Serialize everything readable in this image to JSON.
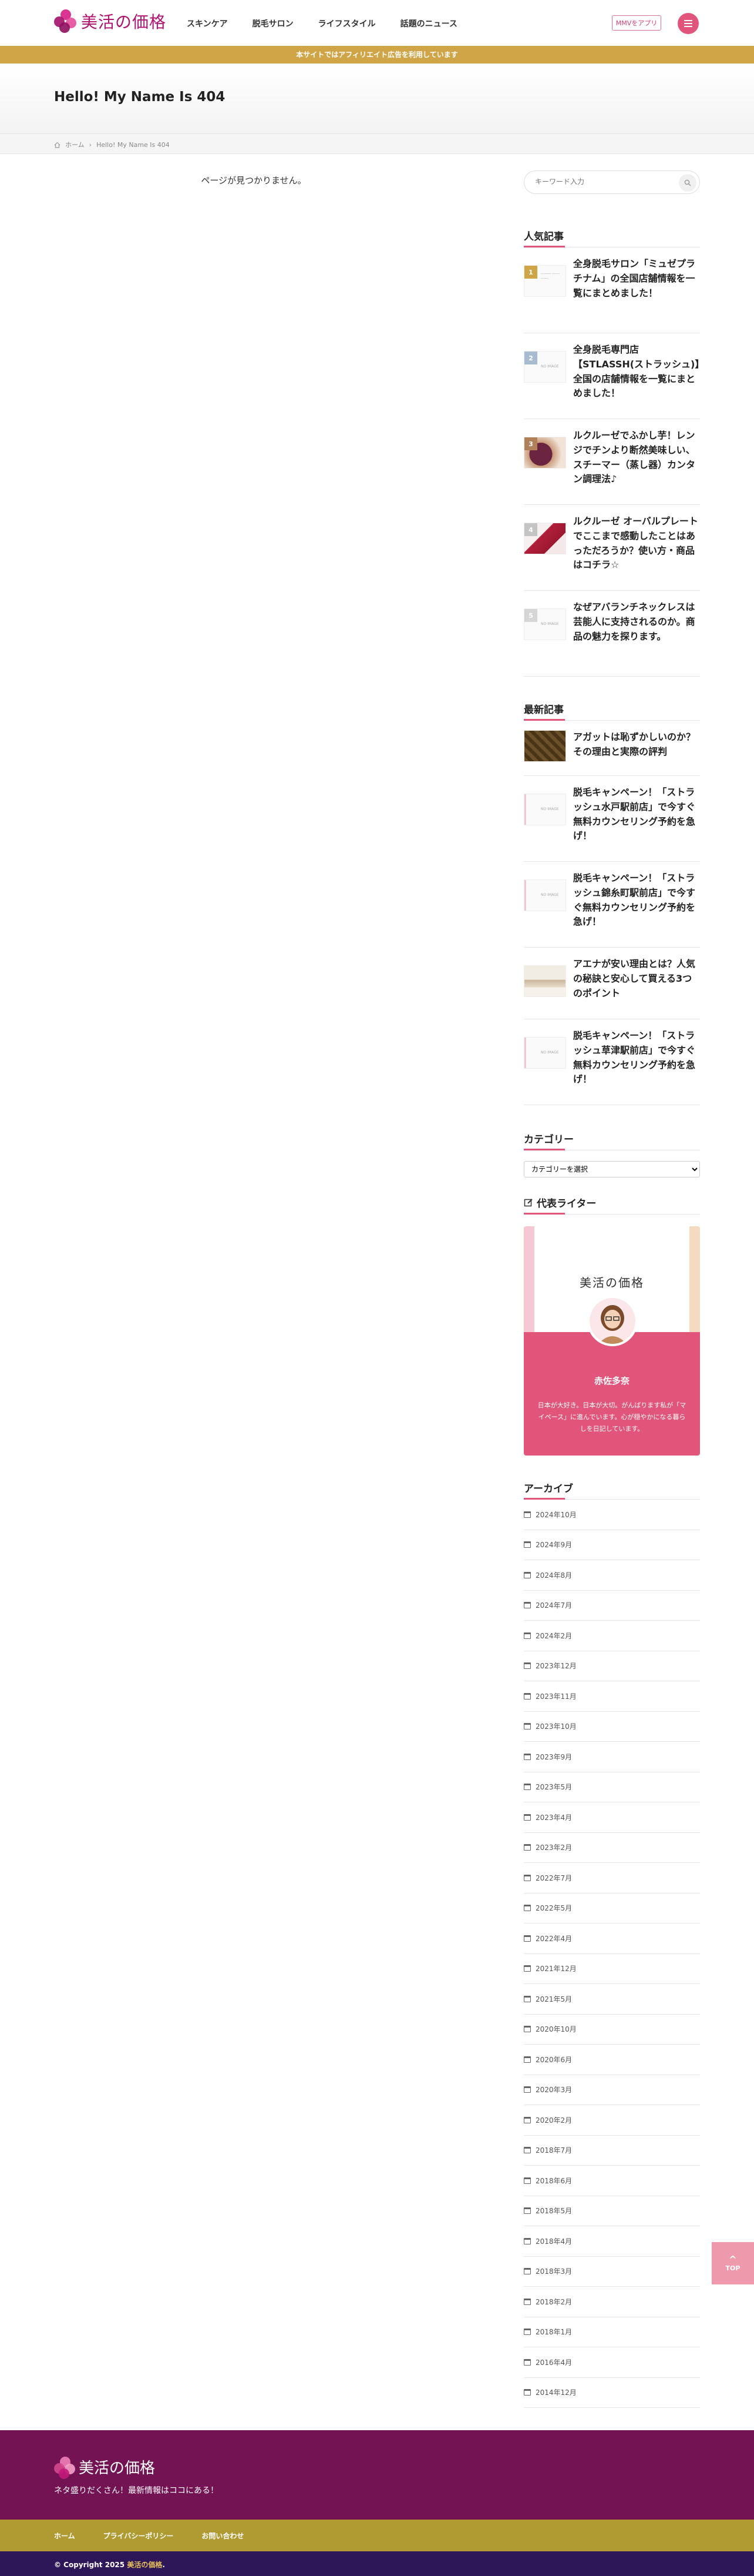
{
  "header": {
    "logo_text": "美活の価格",
    "nav": [
      "スキンケア",
      "脱毛サロン",
      "ライフスタイル",
      "話題のニュース"
    ],
    "app_button": "MMVをアプリ",
    "colors": {
      "brand": "#b0136f",
      "accent": "#e2557a"
    }
  },
  "notice": "本サイトではアフィリエイト広告を利用しています",
  "page_title": "Hello! My Name Is 404",
  "breadcrumb": {
    "home": "ホーム",
    "current": "Hello! My Name Is 404"
  },
  "main": {
    "not_found": "ページが見つかりません。"
  },
  "sidebar": {
    "search_placeholder": "キーワード入力",
    "popular": {
      "title": "人気記事",
      "posts": [
        {
          "rank": "1",
          "title": "全身脱毛サロン「ミュゼプラチナム」の全国店舗情報を一覧にまとめました！"
        },
        {
          "rank": "2",
          "title": "全身脱毛専門店【STLASSH(ストラッシュ)】全国の店舗情報を一覧にまとめました！"
        },
        {
          "rank": "3",
          "title": "ルクルーゼでふかし芋！レンジでチンより断然美味しい、スチーマー（蒸し器）カンタン調理法♪"
        },
        {
          "rank": "4",
          "title": "ルクルーゼ オーバルプレートでここまで感動したことはあっただろうか？使い方・商品はコチラ☆"
        },
        {
          "rank": "5",
          "title": "なぜアバランチネックレスは芸能人に支持されるのか。商品の魅力を探ります。"
        }
      ]
    },
    "recent": {
      "title": "最新記事",
      "posts": [
        {
          "title": "アガットは恥ずかしいのか？その理由と実際の評判"
        },
        {
          "title": "脱毛キャンペーン！「ストラッシュ水戸駅前店」で今すぐ無料カウンセリング予約を急げ！"
        },
        {
          "title": "脱毛キャンペーン！「ストラッシュ錦糸町駅前店」で今すぐ無料カウンセリング予約を急げ！"
        },
        {
          "title": "アエナが安い理由とは？人気の秘訣と安心して買える3つのポイント"
        },
        {
          "title": "脱毛キャンペーン！「ストラッシュ草津駅前店」で今すぐ無料カウンセリング予約を急げ！"
        }
      ]
    },
    "category": {
      "title": "カテゴリー",
      "selected": "カテゴリーを選択"
    },
    "writer": {
      "title": "代表ライター",
      "brand": "美活の価格",
      "name": "赤佐多奈",
      "desc": "日本が大好き。日本が大切。がんばります私が「マイペース」に進んでいます。心が穏やかになる暮らしを日記しています。"
    },
    "archive": {
      "title": "アーカイブ",
      "items": [
        "2024年10月",
        "2024年9月",
        "2024年8月",
        "2024年7月",
        "2024年2月",
        "2023年12月",
        "2023年11月",
        "2023年10月",
        "2023年9月",
        "2023年5月",
        "2023年4月",
        "2023年2月",
        "2022年7月",
        "2022年5月",
        "2022年4月",
        "2021年12月",
        "2021年5月",
        "2020年10月",
        "2020年6月",
        "2020年3月",
        "2020年2月",
        "2018年7月",
        "2018年6月",
        "2018年5月",
        "2018年4月",
        "2018年3月",
        "2018年2月",
        "2018年1月",
        "2016年4月",
        "2014年12月"
      ]
    }
  },
  "to_top": "TOP",
  "footer": {
    "logo_text": "美活の価格",
    "tagline": "ネタ盛りだくさん！最新情報はココにある！",
    "links": [
      "ホーム",
      "プライバシーポリシー",
      "お問い合わせ"
    ],
    "copyright_prefix": "© Copyright 2025",
    "copyright_site": "美活の価格",
    "copyright_suffix": "."
  }
}
